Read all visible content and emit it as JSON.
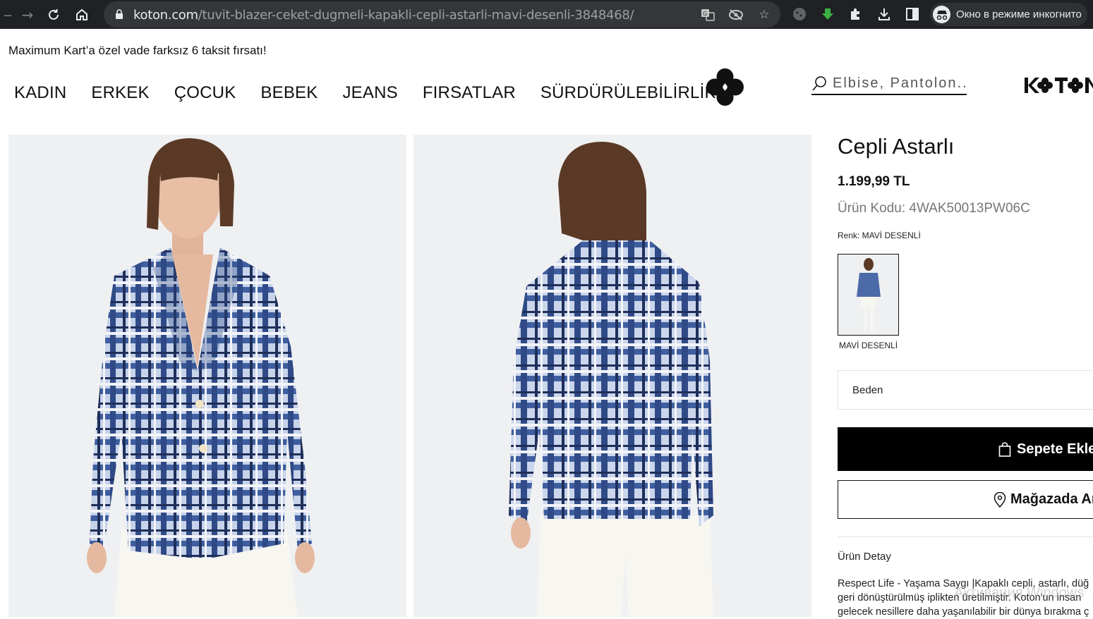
{
  "browser": {
    "url_host": "koton.com",
    "url_path": "/tuvit-blazer-ceket-dugmeli-kapakli-cepli-astarli-mavi-desenli-3848468/",
    "incognito_label": "Окно в режиме инкогнито"
  },
  "promo": {
    "text": "Maximum Kart’a özel vade farksız 6 taksit fırsatı!"
  },
  "nav": {
    "items": [
      "KADIN",
      "ERKEK",
      "ÇOCUK",
      "BEBEK",
      "JEANS",
      "FIRSATLAR",
      "SÜRDÜRÜLEBİLİRLİK"
    ]
  },
  "search": {
    "placeholder": "Elbise, Pantolon..."
  },
  "product": {
    "title": "Cepli Astarlı",
    "price": "1.199,99 TL",
    "code": "Ürün Kodu: 4WAK50013PW06C",
    "color_label": "Renk: MAVİ DESENLİ",
    "swatch_label": "MAVİ DESENLİ",
    "size_label": "Beden",
    "add_to_cart": "Sepete Ekle",
    "find_in_store": "Mağazada Ara",
    "detail_label": "Ürün Detay",
    "description_lines": [
      "Respect Life - Yaşama Saygı |Kapaklı cepli, astarlı, düğ",
      "geri dönüştürülmüş iplikten üretilmiştir. Koton'un insan",
      "gelecek nesillere daha yaşanılabilir bir dünya bırakma ç"
    ]
  },
  "watermark": "Активация Windows",
  "colors": {
    "chrome_bg": "#202124",
    "omnibox_bg": "#35363a",
    "photo_bg": "#eff0f2",
    "jacket_blue": "#3a5a9c",
    "button_black": "#000000"
  }
}
